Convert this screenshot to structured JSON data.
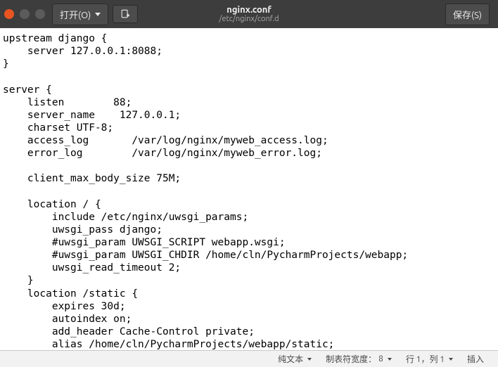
{
  "window": {
    "open_label": "打开(O)",
    "save_label": "保存(S)",
    "title": "nginx.conf",
    "subtitle": "/etc/nginx/conf.d"
  },
  "editor": {
    "content": "upstream django {\n    server 127.0.0.1:8088;\n}\n\nserver {\n    listen        88;\n    server_name    127.0.0.1;\n    charset UTF-8;\n    access_log       /var/log/nginx/myweb_access.log;\n    error_log        /var/log/nginx/myweb_error.log;\n\n    client_max_body_size 75M;\n\n    location / {\n        include /etc/nginx/uwsgi_params;\n        uwsgi_pass django;\n        #uwsgi_param UWSGI_SCRIPT webapp.wsgi;\n        #uwsgi_param UWSGI_CHDIR /home/cln/PycharmProjects/webapp;\n        uwsgi_read_timeout 2;\n    }\n    location /static {\n        expires 30d;\n        autoindex on;\n        add_header Cache-Control private;\n        alias /home/cln/PycharmProjects/webapp/static;\n     }\n }"
  },
  "statusbar": {
    "syntax": "纯文本",
    "tabwidth_label": "制表符宽度：",
    "tabwidth_value": "8",
    "cursor": "行 1，列 1",
    "mode": "插入"
  }
}
